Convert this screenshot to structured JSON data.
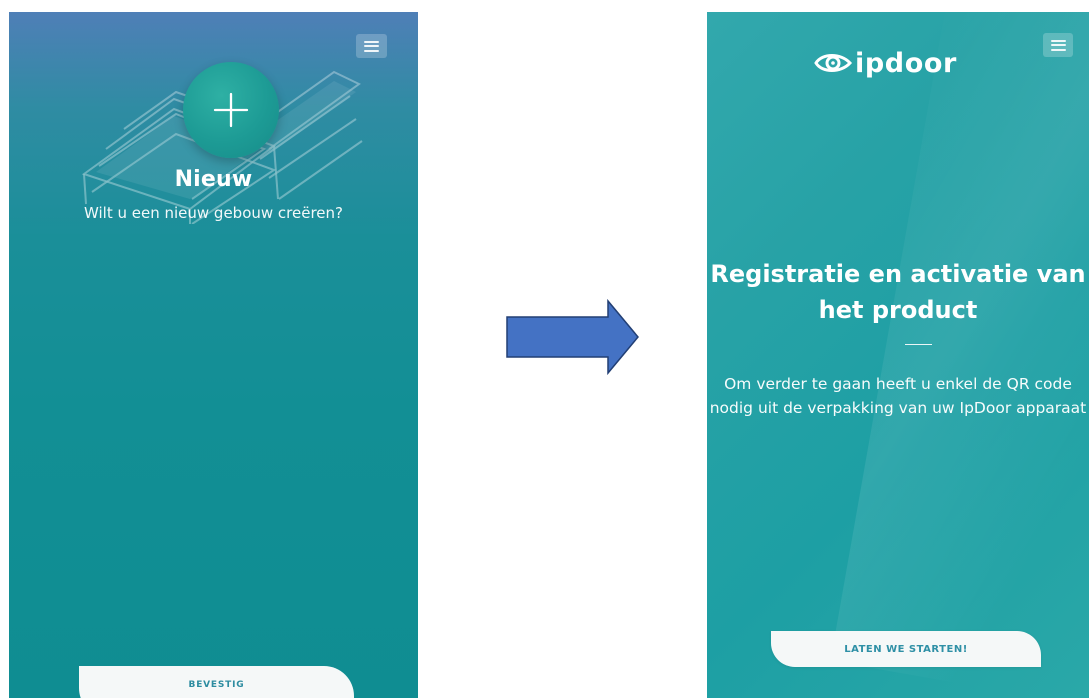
{
  "left_screen": {
    "title": "Nieuw",
    "subtitle": "Wilt u een nieuw gebouw creëren?",
    "button_label": "BEVESTIG",
    "icons": [
      "menu-icon",
      "plus-icon",
      "building-icon"
    ]
  },
  "arrow": {
    "direction": "right",
    "color": "#4472c4"
  },
  "right_screen": {
    "brand": "ipdoor",
    "title": "Registratie en activatie van het product",
    "description": "Om verder te gaan heeft u enkel de QR code nodig uit de verpakking van uw IpDoor apparaat",
    "button_label": "LATEN WE STARTEN!",
    "icons": [
      "ipdoor-eye-logo-icon",
      "menu-icon"
    ]
  },
  "colors": {
    "teal": "#0f8d92",
    "right_teal": "#27a2a6",
    "button_bg": "#f5f8f8",
    "button_text": "#2f90a6"
  }
}
